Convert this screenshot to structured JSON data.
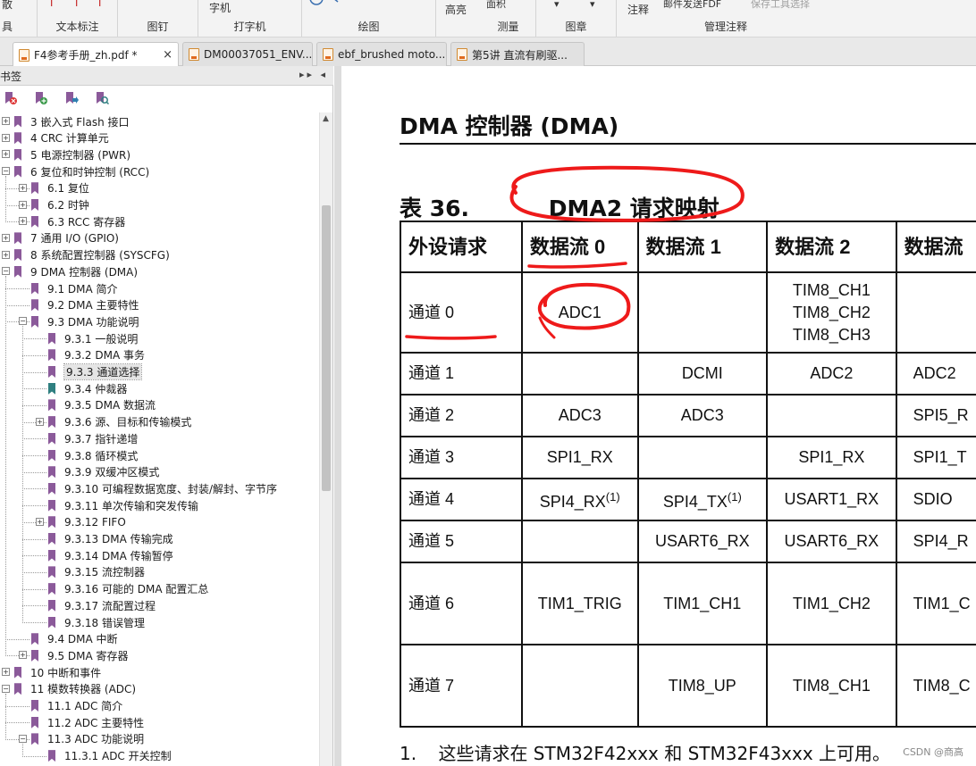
{
  "ribbon": {
    "groups": [
      {
        "label": "具",
        "items": [
          "散"
        ]
      },
      {
        "label": "文本标注",
        "items": [
          "T",
          "T",
          "T"
        ]
      },
      {
        "label": "图钉",
        "items": []
      },
      {
        "label": "打字机",
        "items": [
          "字机"
        ]
      },
      {
        "label": "绘图",
        "items": []
      },
      {
        "label": "测量",
        "items": [
          "高亮",
          "面积"
        ]
      },
      {
        "label": "图章",
        "items": []
      },
      {
        "label": "管理注释",
        "items": [
          "注释",
          "邮件发送FDF",
          "保存工具选择"
        ]
      }
    ]
  },
  "tabs": [
    {
      "title": "F4参考手册_zh.pdf *",
      "active": true,
      "close": "×"
    },
    {
      "title": "DM00037051_ENV...",
      "active": false
    },
    {
      "title": "ebf_brushed moto...",
      "active": false
    },
    {
      "title": "第5讲 直流有刷驱...",
      "active": false
    }
  ],
  "sidebar": {
    "title": "书签",
    "controls": "▸▸ ◂",
    "tools": [
      "delete-bookmark-icon",
      "add-bookmark-icon",
      "goto-bookmark-icon",
      "find-bookmark-icon"
    ],
    "items": [
      {
        "label": "3 嵌入式 Flash 接口",
        "level": 0,
        "expander": "+"
      },
      {
        "label": "4 CRC 计算单元",
        "level": 0,
        "expander": "+"
      },
      {
        "label": "5 电源控制器 (PWR)",
        "level": 0,
        "expander": "+"
      },
      {
        "label": "6 复位和时钟控制 (RCC)",
        "level": 0,
        "expander": "−"
      },
      {
        "label": "6.1 复位",
        "level": 1,
        "expander": "+"
      },
      {
        "label": "6.2 时钟",
        "level": 1,
        "expander": "+"
      },
      {
        "label": "6.3 RCC 寄存器",
        "level": 1,
        "expander": "+"
      },
      {
        "label": "7 通用 I/O (GPIO)",
        "level": 0,
        "expander": "+"
      },
      {
        "label": "8 系统配置控制器 (SYSCFG)",
        "level": 0,
        "expander": "+"
      },
      {
        "label": "9 DMA 控制器 (DMA)",
        "level": 0,
        "expander": "−"
      },
      {
        "label": "9.1 DMA 简介",
        "level": 1,
        "expander": ""
      },
      {
        "label": "9.2 DMA 主要特性",
        "level": 1,
        "expander": ""
      },
      {
        "label": "9.3 DMA 功能说明",
        "level": 1,
        "expander": "−"
      },
      {
        "label": "9.3.1 一般说明",
        "level": 2,
        "expander": ""
      },
      {
        "label": "9.3.2 DMA 事务",
        "level": 2,
        "expander": ""
      },
      {
        "label": "9.3.3 通道选择",
        "level": 2,
        "expander": "",
        "selected": true
      },
      {
        "label": "9.3.4 仲裁器",
        "level": 2,
        "expander": "",
        "teal": true
      },
      {
        "label": "9.3.5 DMA 数据流",
        "level": 2,
        "expander": ""
      },
      {
        "label": "9.3.6 源、目标和传输模式",
        "level": 2,
        "expander": "+"
      },
      {
        "label": "9.3.7 指针递增",
        "level": 2,
        "expander": ""
      },
      {
        "label": "9.3.8 循环模式",
        "level": 2,
        "expander": ""
      },
      {
        "label": "9.3.9 双缓冲区模式",
        "level": 2,
        "expander": ""
      },
      {
        "label": "9.3.10 可编程数据宽度、封装/解封、字节序",
        "level": 2,
        "expander": ""
      },
      {
        "label": "9.3.11 单次传输和突发传输",
        "level": 2,
        "expander": ""
      },
      {
        "label": "9.3.12 FIFO",
        "level": 2,
        "expander": "+"
      },
      {
        "label": "9.3.13 DMA 传输完成",
        "level": 2,
        "expander": ""
      },
      {
        "label": "9.3.14 DMA 传输暂停",
        "level": 2,
        "expander": ""
      },
      {
        "label": "9.3.15 流控制器",
        "level": 2,
        "expander": ""
      },
      {
        "label": "9.3.16 可能的 DMA 配置汇总",
        "level": 2,
        "expander": ""
      },
      {
        "label": "9.3.17 流配置过程",
        "level": 2,
        "expander": ""
      },
      {
        "label": "9.3.18 错误管理",
        "level": 2,
        "expander": ""
      },
      {
        "label": "9.4 DMA 中断",
        "level": 1,
        "expander": ""
      },
      {
        "label": "9.5 DMA 寄存器",
        "level": 1,
        "expander": "+"
      },
      {
        "label": "10 中断和事件",
        "level": 0,
        "expander": "+"
      },
      {
        "label": "11 模数转换器 (ADC)",
        "level": 0,
        "expander": "−"
      },
      {
        "label": "11.1 ADC 简介",
        "level": 1,
        "expander": ""
      },
      {
        "label": "11.2 ADC 主要特性",
        "level": 1,
        "expander": ""
      },
      {
        "label": "11.3 ADC 功能说明",
        "level": 1,
        "expander": "−"
      },
      {
        "label": "11.3.1 ADC 开关控制",
        "level": 2,
        "expander": ""
      }
    ]
  },
  "document": {
    "title": "DMA 控制器 (DMA)",
    "table_caption_num": "表 36.",
    "table_caption_text": "DMA2 请求映射",
    "table": {
      "headers": [
        "外设请求",
        "数据流 0",
        "数据流 1",
        "数据流 2",
        "数据流"
      ],
      "rows": [
        {
          "channel": "通道 0",
          "cells": [
            "ADC1",
            "",
            "TIM8_CH1\nTIM8_CH2\nTIM8_CH3",
            ""
          ]
        },
        {
          "channel": "通道 1",
          "cells": [
            "",
            "DCMI",
            "ADC2",
            "ADC2"
          ]
        },
        {
          "channel": "通道 2",
          "cells": [
            "ADC3",
            "ADC3",
            "",
            "SPI5_R"
          ]
        },
        {
          "channel": "通道 3",
          "cells": [
            "SPI1_RX",
            "",
            "SPI1_RX",
            "SPI1_T"
          ]
        },
        {
          "channel": "通道 4",
          "cells": [
            "SPI4_RX(1)",
            "SPI4_TX(1)",
            "USART1_RX",
            "SDIO"
          ]
        },
        {
          "channel": "通道 5",
          "cells": [
            "",
            "USART6_RX",
            "USART6_RX",
            "SPI4_R"
          ]
        },
        {
          "channel": "通道 6",
          "cells": [
            "TIM1_TRIG",
            "TIM1_CH1",
            "TIM1_CH2",
            "TIM1_C"
          ]
        },
        {
          "channel": "通道 7",
          "cells": [
            "",
            "TIM8_UP",
            "TIM8_CH1",
            "TIM8_C"
          ]
        }
      ]
    },
    "footnote_num": "1.",
    "footnote_text": "这些请求在 STM32F42xxx 和 STM32F43xxx 上可用。",
    "watermark": "CSDN @商高"
  },
  "colors": {
    "annotation": "#ee1a1a",
    "bookmark": "#8b5a9a",
    "bookmark_active": "#2f7f80"
  }
}
